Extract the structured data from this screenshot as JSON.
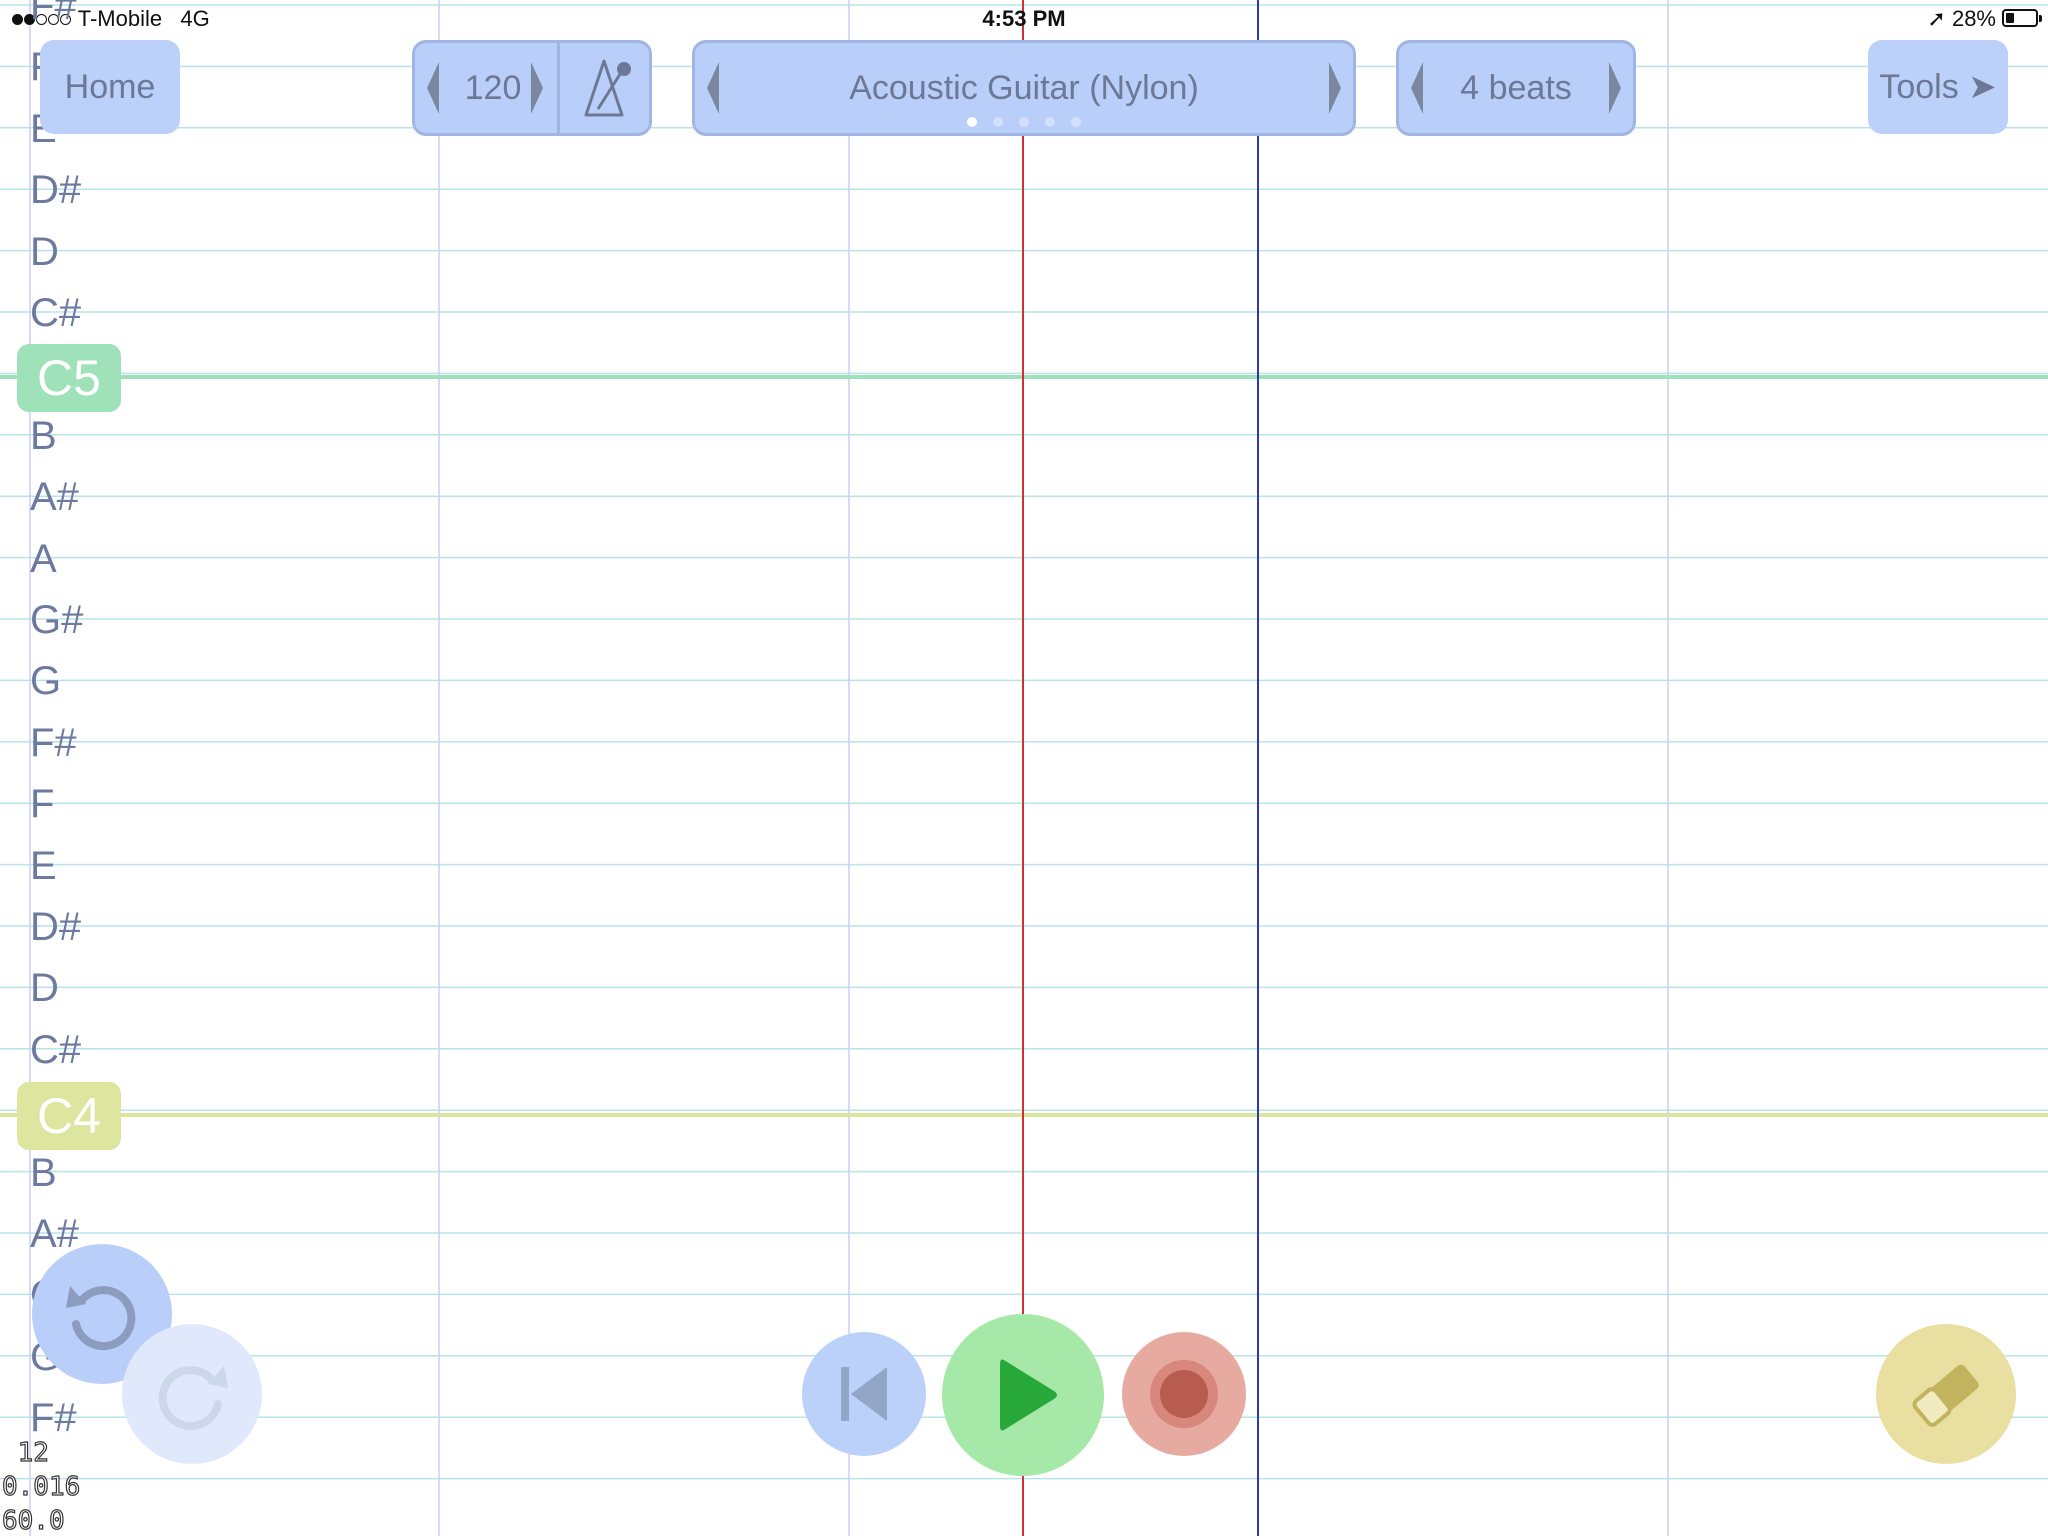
{
  "status_bar": {
    "carrier": "T-Mobile",
    "network": "4G",
    "time": "4:53 PM",
    "battery": "28%",
    "signal_bars_filled": 2,
    "signal_bars_total": 5,
    "battery_level": 0.28
  },
  "toolbar": {
    "home_label": "Home",
    "tempo_value": "120",
    "instrument_label": "Acoustic Guitar (Nylon)",
    "instrument_page_count": 5,
    "instrument_page_active": 1,
    "beats_label": "4 beats",
    "tools_label": "Tools ➤"
  },
  "notes": [
    "F#",
    "F",
    "E",
    "D#",
    "D",
    "C#",
    "C5",
    "B",
    "A#",
    "A",
    "G#",
    "G",
    "F#",
    "F",
    "E",
    "D#",
    "D",
    "C#",
    "C4",
    "B",
    "A#",
    "G",
    "G",
    "F#"
  ],
  "debug_info": " 12\n0.016\n60.0",
  "colors": {
    "accent_blue": "#b9cff9",
    "octave_c5": "#9fe1b8",
    "octave_c4": "#dde59e",
    "play": "#a5e8a7",
    "record": "#e7aaa0",
    "eraser": "#e9dfa1",
    "playhead": "#d03030",
    "end_marker": "#2a3aa8"
  }
}
